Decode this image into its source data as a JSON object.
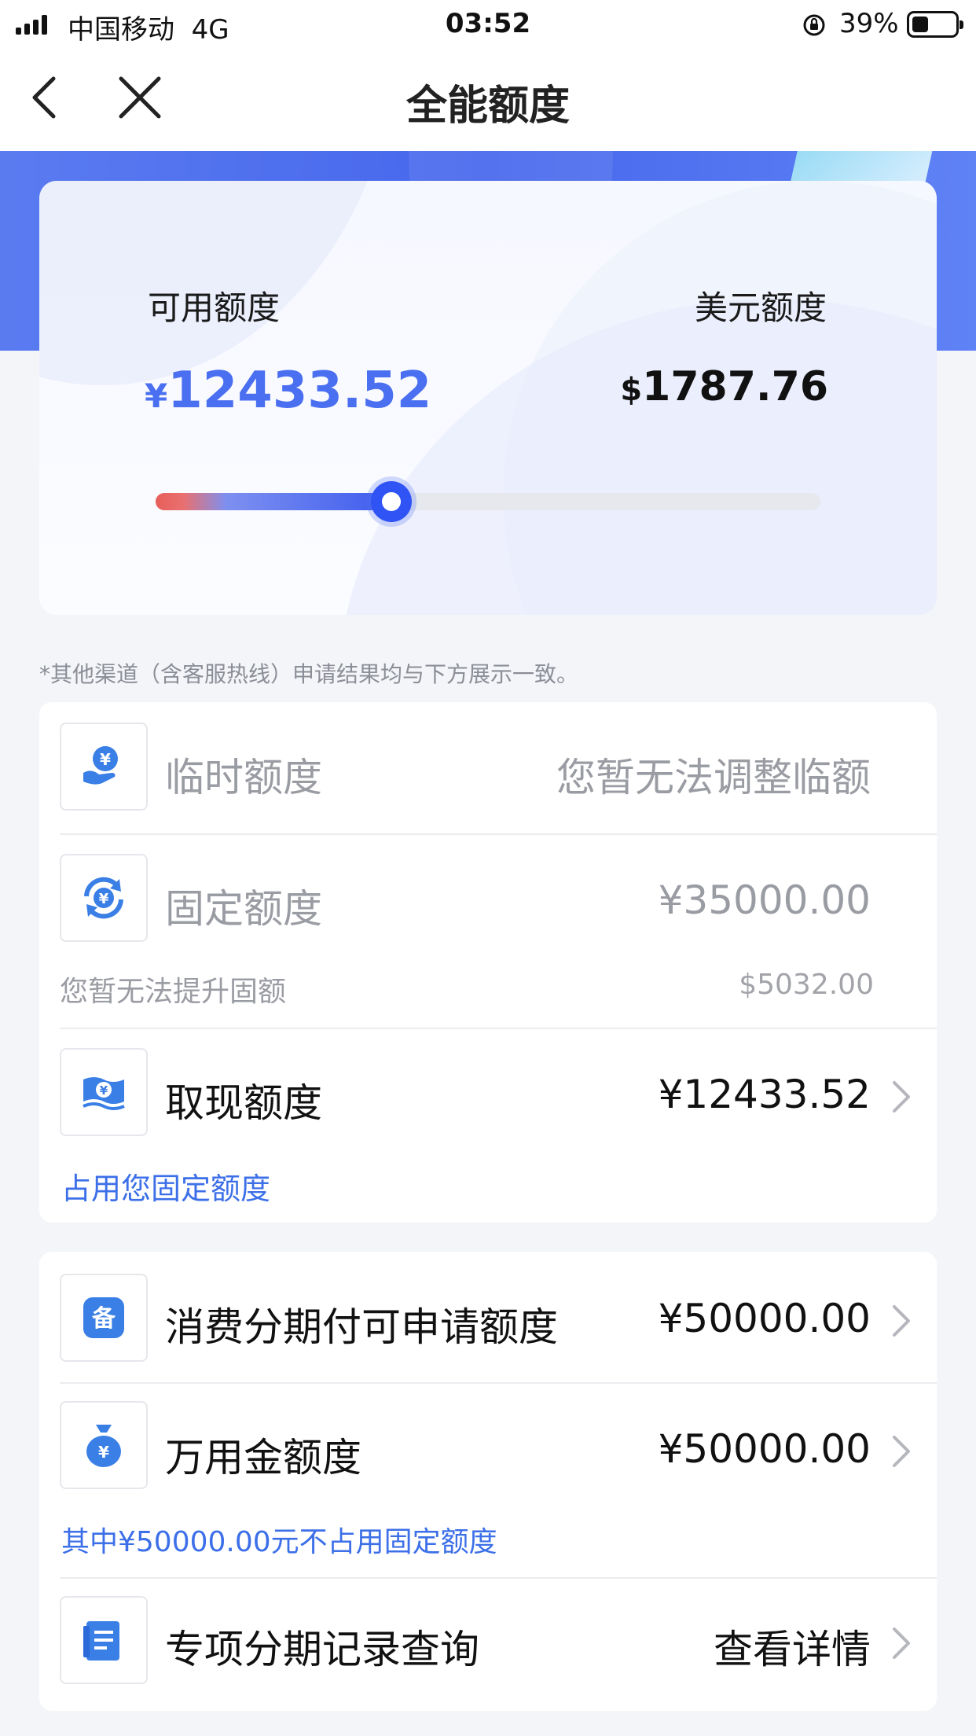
{
  "status_bar": {
    "carrier": "中国移动",
    "network": "4G",
    "time": "03:52",
    "battery": "39%"
  },
  "nav": {
    "title": "全能额度"
  },
  "summary": {
    "available_label": "可用额度",
    "available_currency": "¥",
    "available_amount": "12433.52",
    "usd_label": "美元额度",
    "usd_currency": "$",
    "usd_amount": "1787.76",
    "progress_fraction": 0.355
  },
  "notice": "*其他渠道（含客服热线）申请结果均与下方展示一致。",
  "quota_list": {
    "temporary": {
      "label": "临时额度",
      "value": "您暂无法调整临额",
      "icon": "yuan-hand-icon"
    },
    "fixed": {
      "label": "固定额度",
      "value": "¥35000.00",
      "sub_left": "您暂无法提升固额",
      "sub_right": "$5032.00",
      "icon": "yuan-cycle-icon"
    },
    "cash": {
      "label": "取现额度",
      "value": "¥12433.52",
      "sub_note": "占用您固定额度",
      "icon": "cash-bill-icon"
    }
  },
  "installment_list": {
    "consumer": {
      "label": "消费分期付可申请额度",
      "value": "¥50000.00",
      "icon": "bei-icon"
    },
    "universal": {
      "label": "万用金额度",
      "value": "¥50000.00",
      "sub_note": "其中¥50000.00元不占用固定额度",
      "icon": "money-bag-icon"
    },
    "records": {
      "label": "专项分期记录查询",
      "value": "查看详情",
      "icon": "document-icon"
    }
  },
  "colors": {
    "brand_blue": "#4a6ff0",
    "link_blue": "#3c6fe8",
    "muted": "#9a9ca3"
  }
}
